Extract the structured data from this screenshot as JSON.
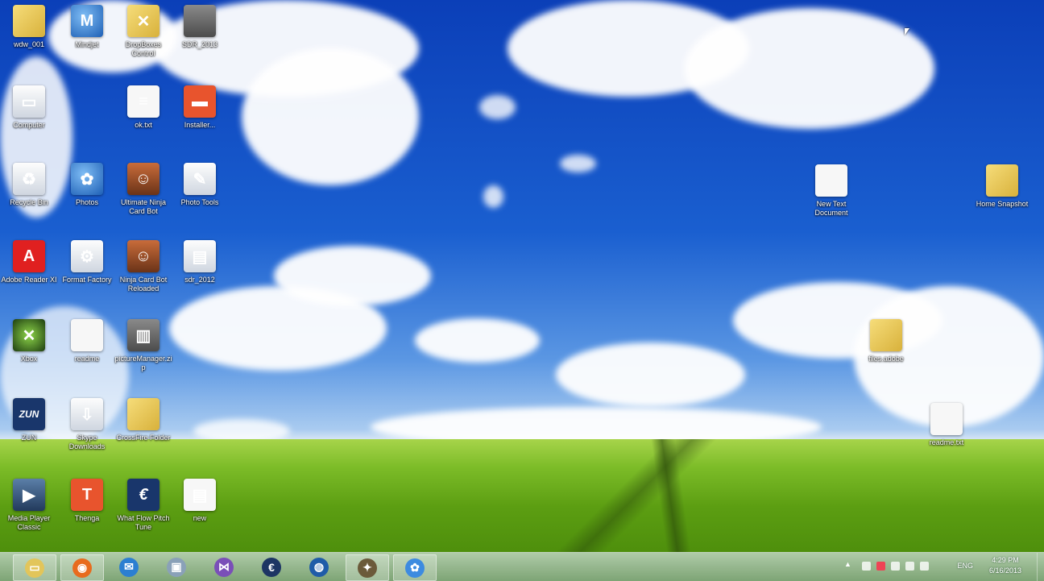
{
  "desktop": {
    "wallpaper": "blue sky, white clouds, green wheat field",
    "icons": [
      {
        "label": "wdw_001",
        "icon": "folder-person-icon",
        "style": "g-folder",
        "glyph": ""
      },
      {
        "label": "Mindjet",
        "icon": "mindjet-icon",
        "style": "g-blue",
        "glyph": "M"
      },
      {
        "label": "DropBoxes Control",
        "icon": "gold-arrows-icon",
        "style": "g-folder",
        "glyph": "✕"
      },
      {
        "label": "SDR_2013",
        "icon": "archive-icon",
        "style": "g-gray",
        "glyph": ""
      },
      {
        "label": "Computer",
        "icon": "computer-icon",
        "style": "g-light",
        "glyph": "▭"
      },
      {
        "label": "ok.txt",
        "icon": "text-file-icon",
        "style": "g-doc",
        "glyph": "≡"
      },
      {
        "label": "Installer...",
        "icon": "installer-icon",
        "style": "g-orange",
        "glyph": "▬"
      },
      {
        "label": "Recycle Bin",
        "icon": "recycle-bin-icon",
        "style": "g-light",
        "glyph": "♻"
      },
      {
        "label": "Photos",
        "icon": "photos-icon",
        "style": "g-blue",
        "glyph": "✿"
      },
      {
        "label": "Ultimate Ninja Card Bot",
        "icon": "ninja-icon",
        "style": "g-person",
        "glyph": "☺"
      },
      {
        "label": "Photo Tools",
        "icon": "photo-tools-icon",
        "style": "g-light",
        "glyph": "✎"
      },
      {
        "label": "Adobe Reader XI",
        "icon": "adobe-reader-icon",
        "style": "g-red",
        "glyph": "A"
      },
      {
        "label": "Format Factory",
        "icon": "format-factory-icon",
        "style": "g-light",
        "glyph": "⚙"
      },
      {
        "label": "Ninja Card Bot Reloaded",
        "icon": "ninja-reloaded-icon",
        "style": "g-person",
        "glyph": "☺"
      },
      {
        "label": "sdr_2012",
        "icon": "cabinet-file-icon",
        "style": "g-light",
        "glyph": "▤"
      },
      {
        "label": "Xbox",
        "icon": "xbox-icon",
        "style": "g-xbox",
        "glyph": "✕"
      },
      {
        "label": "readme",
        "icon": "blank-file-icon",
        "style": "g-doc",
        "glyph": ""
      },
      {
        "label": "pictureManager.zip",
        "icon": "zip-archive-icon",
        "style": "g-gray",
        "glyph": "▥"
      },
      {
        "label": "ZUN",
        "icon": "zun-icon",
        "style": "g-navy",
        "glyph": "ZUN"
      },
      {
        "label": "Skype Downloads",
        "icon": "downloads-icon",
        "style": "g-light",
        "glyph": "⇩"
      },
      {
        "label": "CrossFire Folder",
        "icon": "folder-icon",
        "style": "g-folder",
        "glyph": ""
      },
      {
        "label": "Media Player Classic",
        "icon": "media-player-icon",
        "style": "g-film",
        "glyph": "▶"
      },
      {
        "label": "Thenga",
        "icon": "thenga-icon",
        "style": "g-orange",
        "glyph": "T"
      },
      {
        "label": "What Flow Pitch Tune",
        "icon": "euro-e-icon",
        "style": "g-navy",
        "glyph": "€"
      },
      {
        "label": "new",
        "icon": "new-documents-icon",
        "style": "g-doc",
        "glyph": "▤"
      },
      {
        "label": "New Text Document",
        "icon": "text-document-icon",
        "style": "g-doc",
        "glyph": ""
      },
      {
        "label": "Home Snapshot",
        "icon": "folder-icon",
        "style": "g-folder",
        "glyph": ""
      },
      {
        "label": "files.adobe",
        "icon": "folder-icon",
        "style": "g-folder",
        "glyph": ""
      },
      {
        "label": "readme.txt",
        "icon": "blank-file-icon",
        "style": "g-doc",
        "glyph": ""
      }
    ]
  },
  "taskbar": {
    "buttons": [
      {
        "name": "file-explorer",
        "icon": "file-explorer-icon",
        "glyph": "▭",
        "color": "#e2c55a",
        "active": true
      },
      {
        "name": "firefox",
        "icon": "firefox-icon",
        "glyph": "◉",
        "color": "#e86b1d",
        "active": true
      },
      {
        "name": "mail",
        "icon": "mail-icon",
        "glyph": "✉",
        "color": "#2c7fd1",
        "active": false
      },
      {
        "name": "device-manager",
        "icon": "device-icon",
        "glyph": "▣",
        "color": "#8aa1b8",
        "active": false
      },
      {
        "name": "visual-studio",
        "icon": "visual-studio-icon",
        "glyph": "⋈",
        "color": "#7a4fb8",
        "active": false
      },
      {
        "name": "euro-app",
        "icon": "euro-e-icon",
        "glyph": "€",
        "color": "#1d3564",
        "active": false
      },
      {
        "name": "globe-app",
        "icon": "globe-icon",
        "glyph": "◍",
        "color": "#1f5ca8",
        "active": false
      },
      {
        "name": "dog-app",
        "icon": "dog-icon",
        "glyph": "✦",
        "color": "#6b5a3a",
        "active": true
      },
      {
        "name": "photos-app",
        "icon": "photos-icon",
        "glyph": "✿",
        "color": "#3d8be0",
        "active": true
      }
    ],
    "tray": {
      "language": "ENG",
      "time": "4:29 PM",
      "date": "6/16/2013"
    }
  }
}
